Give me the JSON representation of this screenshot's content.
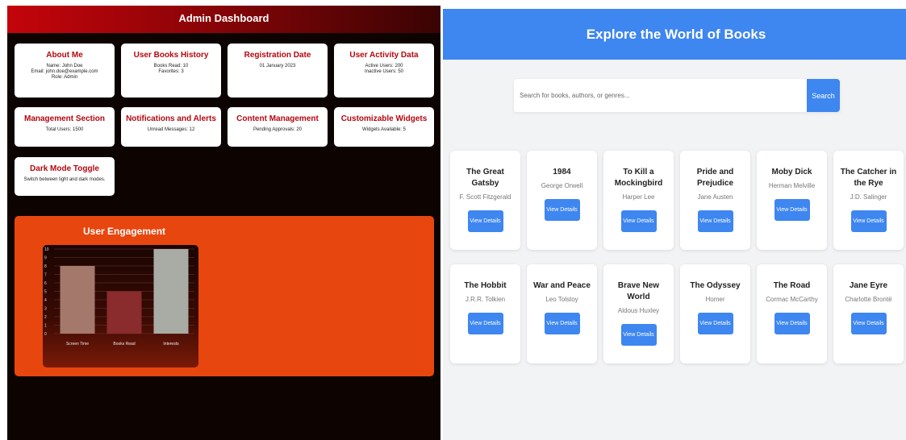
{
  "admin": {
    "title": "Admin Dashboard",
    "cards": [
      {
        "title": "About Me",
        "lines": [
          "Name: John Doe",
          "Email: john.doe@example.com",
          "Role: Admin"
        ]
      },
      {
        "title": "User Books History",
        "lines": [
          "Books Read: 10",
          "Favorites: 3"
        ]
      },
      {
        "title": "Registration Date",
        "lines": [
          "01 January 2023"
        ]
      },
      {
        "title": "User Activity Data",
        "lines": [
          "Active Users: 200",
          "Inactive Users: 50"
        ]
      },
      {
        "title": "Management Section",
        "lines": [
          "Total Users: 1500"
        ]
      },
      {
        "title": "Notifications and Alerts",
        "lines": [
          "Unread Messages: 12"
        ]
      },
      {
        "title": "Content Management",
        "lines": [
          "Pending Approvals: 20"
        ]
      },
      {
        "title": "Customizable Widgets",
        "lines": [
          "Widgets Available: 5"
        ]
      },
      {
        "title": "Dark Mode Toggle",
        "lines": [
          "Switch between light and dark modes."
        ]
      }
    ],
    "engagement_title": "User Engagement"
  },
  "chart_data": {
    "type": "bar",
    "title": "",
    "xlabel": "",
    "ylabel": "",
    "categories": [
      "Screen Time",
      "Books Read",
      "Interests"
    ],
    "values": [
      8,
      5,
      10
    ],
    "ylim": [
      0,
      10
    ],
    "yticks": [
      "0",
      "1",
      "2",
      "3",
      "4",
      "5",
      "6",
      "7",
      "8",
      "9",
      "10"
    ],
    "colors": [
      "#a5786c",
      "#8a2b2e",
      "#a9aca4"
    ],
    "grid": true
  },
  "books_page": {
    "title": "Explore the World of Books",
    "search": {
      "placeholder": "Search for books, authors, or genres...",
      "button": "Search"
    },
    "details_label": "View Details",
    "books": [
      {
        "title": "The Great Gatsby",
        "author": "F. Scott Fitzgerald"
      },
      {
        "title": "1984",
        "author": "George Orwell"
      },
      {
        "title": "To Kill a Mockingbird",
        "author": "Harper Lee"
      },
      {
        "title": "Pride and Prejudice",
        "author": "Jane Austen"
      },
      {
        "title": "Moby Dick",
        "author": "Herman Melville"
      },
      {
        "title": "The Catcher in the Rye",
        "author": "J.D. Salinger"
      },
      {
        "title": "The Hobbit",
        "author": "J.R.R. Tolkien"
      },
      {
        "title": "War and Peace",
        "author": "Leo Tolstoy"
      },
      {
        "title": "Brave New World",
        "author": "Aldous Huxley"
      },
      {
        "title": "The Odyssey",
        "author": "Homer"
      },
      {
        "title": "The Road",
        "author": "Cormac McCarthy"
      },
      {
        "title": "Jane Eyre",
        "author": "Charlotte Brontë"
      }
    ]
  }
}
